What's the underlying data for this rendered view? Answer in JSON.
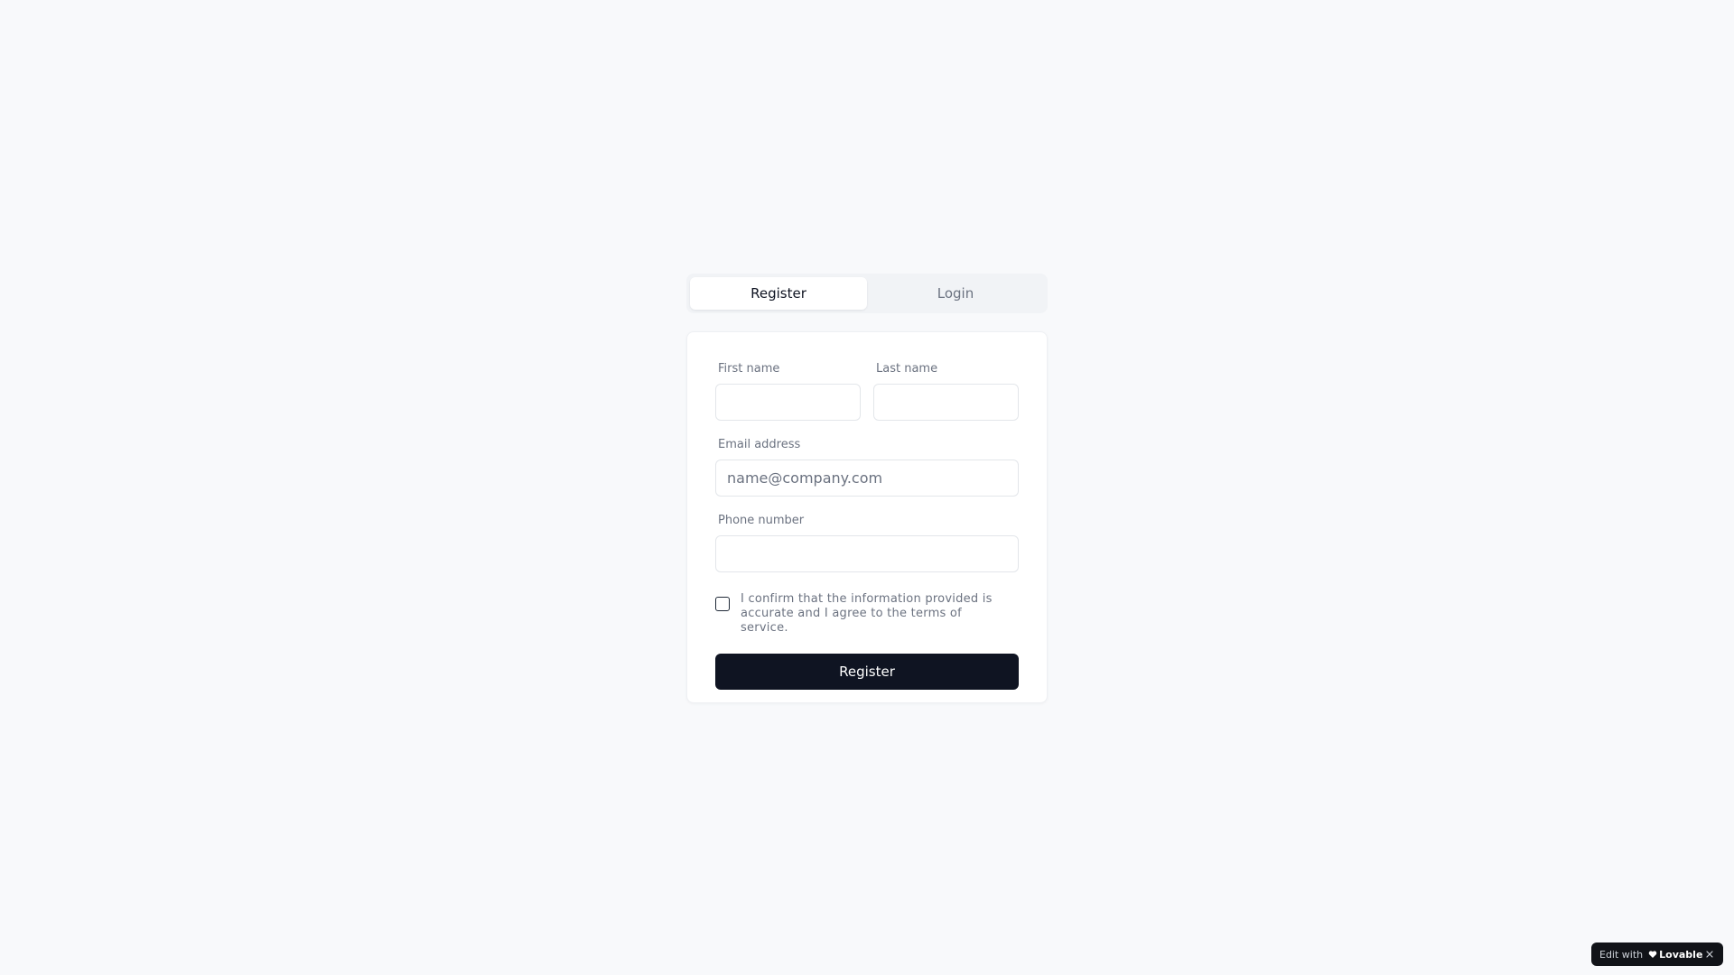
{
  "tabs": [
    {
      "label": "Register",
      "active": true
    },
    {
      "label": "Login",
      "active": false
    }
  ],
  "form": {
    "first_name_label": "First name",
    "first_name_value": "",
    "last_name_label": "Last name",
    "last_name_value": "",
    "email_label": "Email address",
    "email_placeholder": "name@company.com",
    "email_value": "",
    "phone_label": "Phone number",
    "phone_value": "",
    "confirm_text": "I confirm that the information provided is accurate and I agree to the terms of service.",
    "confirm_checked": false,
    "submit_label": "Register"
  },
  "badge": {
    "prefix": "Edit with",
    "brand": "Lovable",
    "brand_icon": "heart-icon",
    "close_icon": "close-icon"
  },
  "colors": {
    "background": "#f8f9fb",
    "primary": "#0f1422",
    "muted_text": "#6b7280",
    "border": "#e3e6ea"
  }
}
